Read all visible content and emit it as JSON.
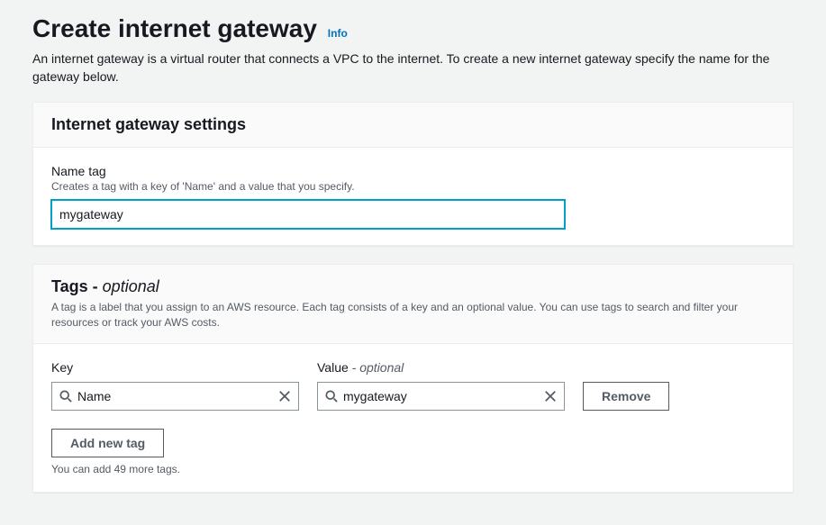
{
  "header": {
    "title": "Create internet gateway",
    "info_label": "Info",
    "description": "An internet gateway is a virtual router that connects a VPC to the internet. To create a new internet gateway specify the name for the gateway below."
  },
  "settings_panel": {
    "title": "Internet gateway settings",
    "name_tag": {
      "label": "Name tag",
      "hint": "Creates a tag with a key of 'Name' and a value that you specify.",
      "value": "mygateway"
    }
  },
  "tags_panel": {
    "title_prefix": "Tags - ",
    "title_suffix": "optional",
    "description": "A tag is a label that you assign to an AWS resource. Each tag consists of a key and an optional value. You can use tags to search and filter your resources or track your AWS costs.",
    "key_label": "Key",
    "value_label_prefix": "Value ",
    "value_label_suffix": "- optional",
    "rows": [
      {
        "key": "Name",
        "value": "mygateway"
      }
    ],
    "remove_label": "Remove",
    "add_label": "Add new tag",
    "count_hint": "You can add 49 more tags."
  }
}
